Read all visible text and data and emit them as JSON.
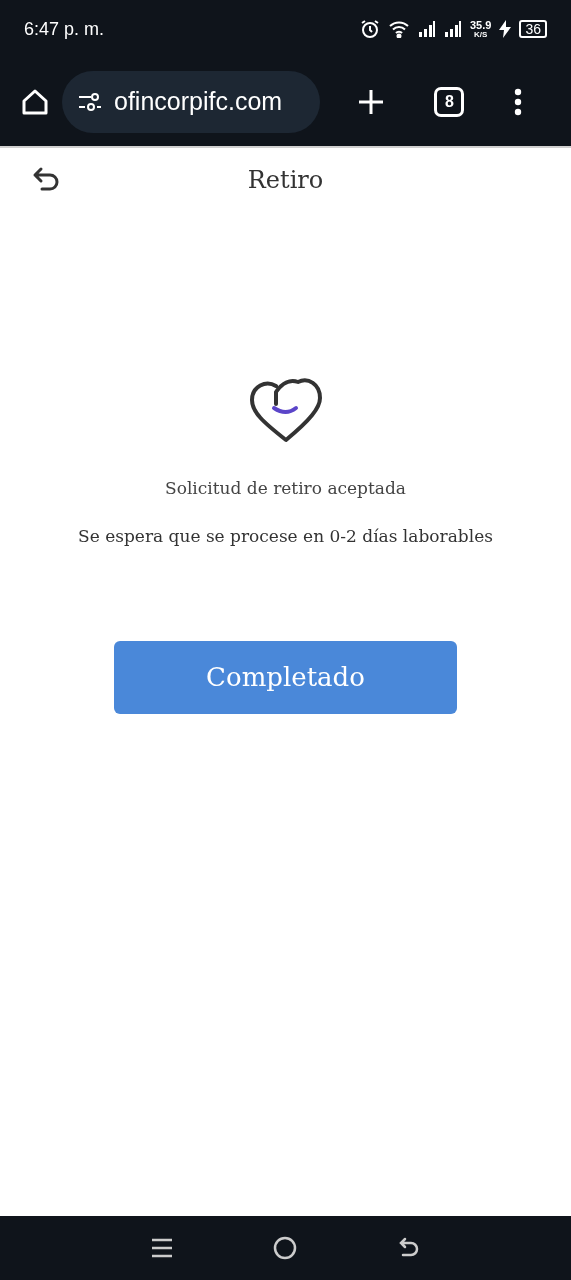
{
  "status_bar": {
    "time": "6:47 p. m.",
    "speed": "35.9",
    "speed_unit": "K/S",
    "battery": "36"
  },
  "browser": {
    "url": "ofincorpifc.com",
    "tab_count": "8"
  },
  "header": {
    "title": "Retiro"
  },
  "message": {
    "title": "Solicitud de retiro aceptada",
    "subtitle": "Se espera que se procese en 0-2 días laborables"
  },
  "button": {
    "label": "Completado"
  }
}
